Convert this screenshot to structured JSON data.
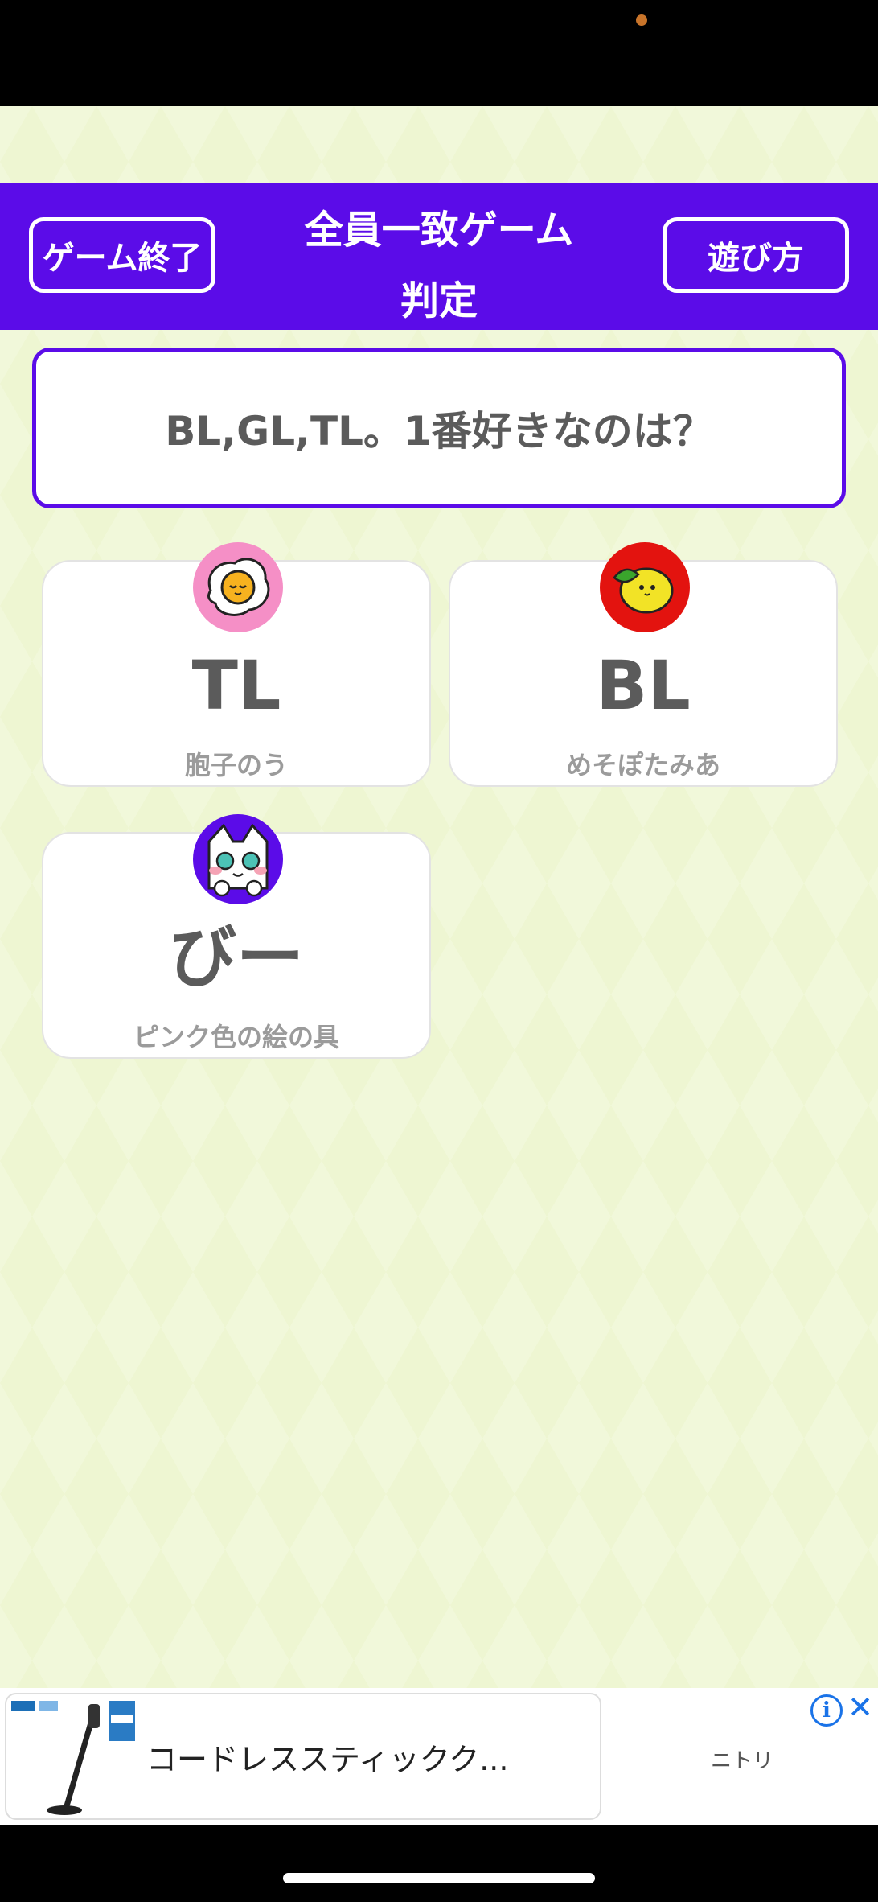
{
  "header": {
    "title": "全員一致ゲーム",
    "subtitle": "判定",
    "end_button": "ゲーム終了",
    "howto_button": "遊び方"
  },
  "question": "BL,GL,TL。1番好きなのは？",
  "answers": [
    {
      "answer": "TL",
      "player": "胞子のう",
      "avatar_icon": "fried-egg-icon",
      "avatar_bg": "#f58fc6"
    },
    {
      "answer": "BL",
      "player": "めそぽたみあ",
      "avatar_icon": "lemon-icon",
      "avatar_bg": "#e3130f"
    },
    {
      "answer": "びー",
      "player": "ピンク色の絵の具",
      "avatar_icon": "white-cat-icon",
      "avatar_bg": "#5b0ce8"
    }
  ],
  "ad": {
    "text": "コードレススティックク...",
    "advertiser": "ニトリ",
    "info_label": "i",
    "close_label": "✕"
  },
  "colors": {
    "accent": "#5b0ce8",
    "background": "#eef6d2"
  }
}
